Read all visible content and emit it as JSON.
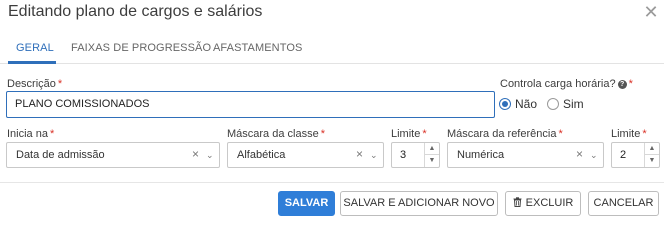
{
  "dialog": {
    "title": "Editando plano de cargos e salários"
  },
  "tabs": [
    {
      "label": "GERAL",
      "active": true
    },
    {
      "label": "FAIXAS DE PROGRESSÃO",
      "active": false
    },
    {
      "label": "AFASTAMENTOS",
      "active": false
    }
  ],
  "form": {
    "descricao": {
      "label": "Descrição",
      "value": "PLANO COMISSIONADOS"
    },
    "controla_carga": {
      "label": "Controla carga horária?",
      "options": [
        {
          "label": "Não",
          "checked": true
        },
        {
          "label": "Sim",
          "checked": false
        }
      ]
    },
    "inicia_na": {
      "label": "Inicia na",
      "value": "Data de admissão"
    },
    "mascara_classe": {
      "label": "Máscara da classe",
      "value": "Alfabética"
    },
    "limite_classe": {
      "label": "Limite",
      "value": "3"
    },
    "mascara_referencia": {
      "label": "Máscara da referência",
      "value": "Numérica"
    },
    "limite_referencia": {
      "label": "Limite",
      "value": "2"
    },
    "required_mark": "*"
  },
  "buttons": {
    "save": "SALVAR",
    "save_add": "SALVAR E ADICIONAR NOVO",
    "delete": "EXCLUIR",
    "cancel": "CANCELAR"
  },
  "icons": {
    "close": "close-icon",
    "help": "help-icon",
    "trash": "trash-icon",
    "clear": "clear-icon",
    "caret": "chevron-down-icon"
  },
  "colors": {
    "accent": "#2f6fba",
    "primary_button": "#2f7ed8",
    "required": "#d93025"
  }
}
